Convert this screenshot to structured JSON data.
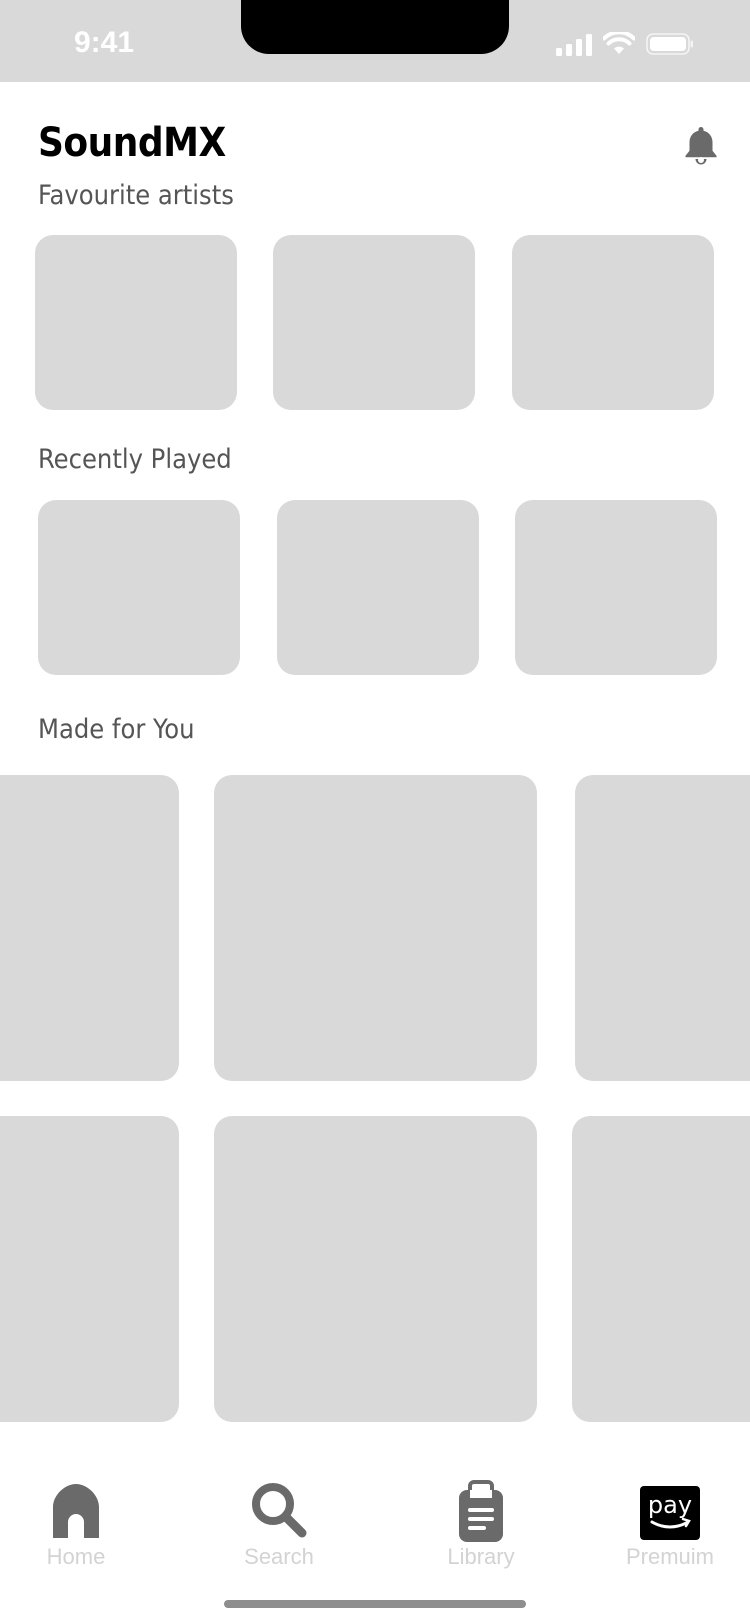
{
  "status_bar": {
    "time": "9:41"
  },
  "header": {
    "app_title": "SoundMX",
    "bell_icon": "bell-icon"
  },
  "sections": {
    "favourite_artists": "Favourite  artists",
    "recently_played": "Recently Played",
    "made_for_you": "Made for You"
  },
  "tab_bar": {
    "tabs": [
      {
        "label": "Home",
        "icon": "home-icon"
      },
      {
        "label": "Search",
        "icon": "search-icon"
      },
      {
        "label": "Library",
        "icon": "clipboard-icon"
      },
      {
        "label": "Premuim",
        "icon": "amazon-pay-icon"
      }
    ]
  },
  "colors": {
    "placeholder": "#d9d9d9",
    "icon": "#6a6a6a",
    "tab_label": "#d3d3d3",
    "section_title": "#555555"
  }
}
